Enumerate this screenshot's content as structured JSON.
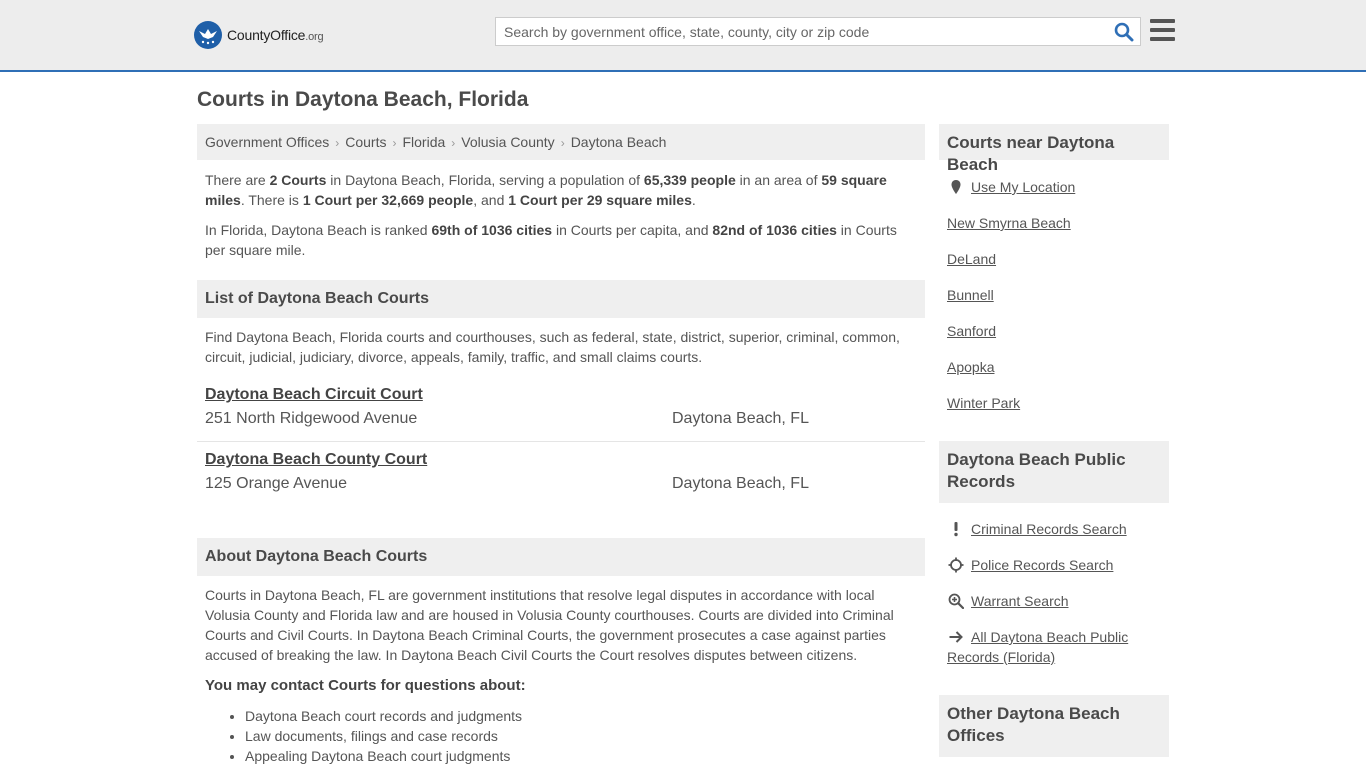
{
  "header": {
    "logo_text": "CountyOffice",
    "logo_suffix": ".org",
    "search_placeholder": "Search by government office, state, county, city or zip code"
  },
  "page_title": "Courts in Daytona Beach, Florida",
  "breadcrumb": [
    "Government Offices",
    "Courts",
    "Florida",
    "Volusia County",
    "Daytona Beach"
  ],
  "intro": {
    "p1": {
      "a": "There are ",
      "b1": "2 Courts",
      "c": " in Daytona Beach, Florida, serving a population of ",
      "b2": "65,339 people",
      "d": " in an area of ",
      "b3": "59 square miles",
      "e": ". There is ",
      "b4": "1 Court per 32,669 people",
      "f": ", and ",
      "b5": "1 Court per 29 square miles",
      "g": "."
    },
    "p2": {
      "a": "In Florida, Daytona Beach is ranked ",
      "b1": "69th of 1036 cities",
      "c": " in Courts per capita, and ",
      "b2": "82nd of 1036 cities",
      "d": " in Courts per square mile."
    }
  },
  "list_section": {
    "title": "List of Daytona Beach Courts",
    "description": "Find Daytona Beach, Florida courts and courthouses, such as federal, state, district, superior, criminal, common, circuit, judicial, judiciary, divorce, appeals, family, traffic, and small claims courts.",
    "courts": [
      {
        "name": "Daytona Beach Circuit Court",
        "address": "251 North Ridgewood Avenue",
        "city": "Daytona Beach, FL"
      },
      {
        "name": "Daytona Beach County Court",
        "address": "125 Orange Avenue",
        "city": "Daytona Beach, FL"
      }
    ]
  },
  "about_section": {
    "title": "About Daytona Beach Courts",
    "text": "Courts in Daytona Beach, FL are government institutions that resolve legal disputes in accordance with local Volusia County and Florida law and are housed in Volusia County courthouses. Courts are divided into Criminal Courts and Civil Courts. In Daytona Beach Criminal Courts, the government prosecutes a case against parties accused of breaking the law. In Daytona Beach Civil Courts the Court resolves disputes between citizens.",
    "contact_title": "You may contact Courts for questions about:",
    "contact_items": [
      "Daytona Beach court records and judgments",
      "Law documents, filings and case records",
      "Appealing Daytona Beach court judgments"
    ]
  },
  "sidebar": {
    "nearby_title": "Courts near Daytona Beach",
    "use_location": "Use My Location",
    "nearby": [
      "New Smyrna Beach",
      "DeLand",
      "Bunnell",
      "Sanford",
      "Apopka",
      "Winter Park"
    ],
    "records_title": "Daytona Beach Public Records",
    "records": [
      {
        "label": "Criminal Records Search",
        "icon": "exclamation-icon"
      },
      {
        "label": "Police Records Search",
        "icon": "crosshair-icon"
      },
      {
        "label": "Warrant Search",
        "icon": "magnifier-plus-icon"
      },
      {
        "label": "All Daytona Beach Public Records (Florida)",
        "icon": "arrow-right-icon"
      }
    ],
    "other_title": "Other Daytona Beach Offices"
  },
  "colors": {
    "header_bg": "#ededed",
    "header_rule": "#2f6fb6",
    "logo_blue": "#1f5fa8",
    "search_icon": "#2f6fb6",
    "panel_bg": "#efefef"
  }
}
